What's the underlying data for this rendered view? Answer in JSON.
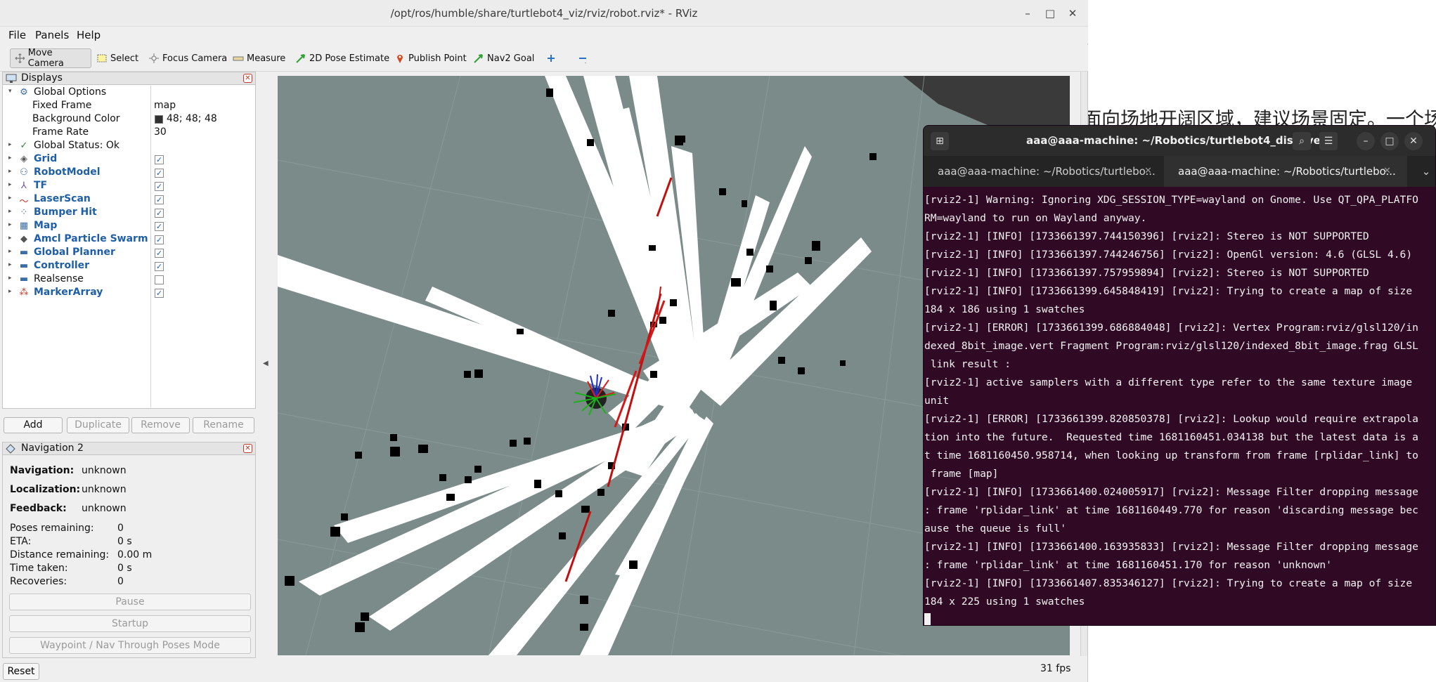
{
  "background_doc": {
    "text": "面向场地开阔区域，建议场景固定。一个场"
  },
  "rviz": {
    "title": "/opt/ros/humble/share/turtlebot4_viz/rviz/robot.rviz* - RViz",
    "menu": [
      "File",
      "Panels",
      "Help"
    ],
    "toolbar": {
      "move_camera": "Move Camera",
      "select": "Select",
      "focus_camera": "Focus Camera",
      "measure": "Measure",
      "pose_estimate": "2D Pose Estimate",
      "publish_point": "Publish Point",
      "nav2_goal": "Nav2 Goal"
    },
    "displays": {
      "title": "Displays",
      "global_options": "Global Options",
      "fixed_frame_label": "Fixed Frame",
      "fixed_frame_value": "map",
      "background_color_label": "Background Color",
      "background_color_value": "48; 48; 48",
      "background_color_hex": "#303030",
      "frame_rate_label": "Frame Rate",
      "frame_rate_value": "30",
      "global_status": "Global Status: Ok",
      "items": [
        {
          "label": "Grid",
          "checked": true
        },
        {
          "label": "RobotModel",
          "checked": true
        },
        {
          "label": "TF",
          "checked": true
        },
        {
          "label": "LaserScan",
          "checked": true
        },
        {
          "label": "Bumper Hit",
          "checked": true
        },
        {
          "label": "Map",
          "checked": true
        },
        {
          "label": "Amcl Particle Swarm",
          "checked": true
        },
        {
          "label": "Global Planner",
          "checked": true
        },
        {
          "label": "Controller",
          "checked": true
        },
        {
          "label": "Realsense",
          "checked": false
        },
        {
          "label": "MarkerArray",
          "checked": true
        }
      ],
      "buttons": {
        "add": "Add",
        "duplicate": "Duplicate",
        "remove": "Remove",
        "rename": "Rename"
      }
    },
    "nav2": {
      "title": "Navigation 2",
      "navigation_label": "Navigation:",
      "navigation_value": "unknown",
      "localization_label": "Localization:",
      "localization_value": "unknown",
      "feedback_label": "Feedback:",
      "feedback_value": "unknown",
      "poses_remaining_label": "Poses remaining:",
      "poses_remaining_value": "0",
      "eta_label": "ETA:",
      "eta_value": "0 s",
      "distance_label": "Distance remaining:",
      "distance_value": "0.00 m",
      "time_taken_label": "Time taken:",
      "time_taken_value": "0 s",
      "recoveries_label": "Recoveries:",
      "recoveries_value": "0",
      "pause": "Pause",
      "startup": "Startup",
      "waypoint_mode": "Waypoint / Nav Through Poses Mode"
    },
    "reset": "Reset",
    "fps": "31 fps"
  },
  "terminal": {
    "title": "aaa@aaa-machine: ~/Robotics/turtlebot4_discovery",
    "tabs": [
      {
        "label": "aaa@aaa-machine: ~/Robotics/turtlebo...",
        "active": false
      },
      {
        "label": "aaa@aaa-machine: ~/Robotics/turtlebo...",
        "active": true
      }
    ],
    "lines": [
      "[rviz2-1] Warning: Ignoring XDG_SESSION_TYPE=wayland on Gnome. Use QT_QPA_PLATFO",
      "RM=wayland to run on Wayland anyway.",
      "[rviz2-1] [INFO] [1733661397.744150396] [rviz2]: Stereo is NOT SUPPORTED",
      "[rviz2-1] [INFO] [1733661397.744246756] [rviz2]: OpenGl version: 4.6 (GLSL 4.6)",
      "[rviz2-1] [INFO] [1733661397.757959894] [rviz2]: Stereo is NOT SUPPORTED",
      "[rviz2-1] [INFO] [1733661399.645848419] [rviz2]: Trying to create a map of size",
      "184 x 186 using 1 swatches",
      "[rviz2-1] [ERROR] [1733661399.686884048] [rviz2]: Vertex Program:rviz/glsl120/in",
      "dexed_8bit_image.vert Fragment Program:rviz/glsl120/indexed_8bit_image.frag GLSL",
      " link result :",
      "[rviz2-1] active samplers with a different type refer to the same texture image",
      "unit",
      "[rviz2-1] [ERROR] [1733661399.820850378] [rviz2]: Lookup would require extrapola",
      "tion into the future.  Requested time 1681160451.034138 but the latest data is a",
      "t time 1681160450.958714, when looking up transform from frame [rplidar_link] to",
      " frame [map]",
      "[rviz2-1] [INFO] [1733661400.024005917] [rviz2]: Message Filter dropping message",
      ": frame 'rplidar_link' at time 1681160449.770 for reason 'discarding message bec",
      "ause the queue is full'",
      "[rviz2-1] [INFO] [1733661400.163935833] [rviz2]: Message Filter dropping message",
      ": frame 'rplidar_link' at time 1681160451.170 for reason 'unknown'",
      "[rviz2-1] [INFO] [1733661407.835346127] [rviz2]: Trying to create a map of size",
      "184 x 225 using 1 swatches"
    ]
  }
}
